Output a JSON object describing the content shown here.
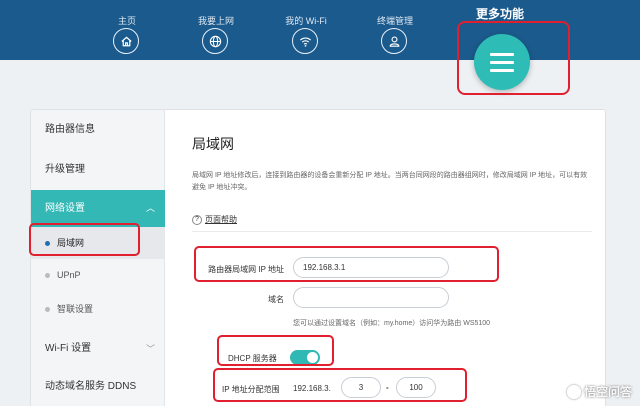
{
  "nav": {
    "items": [
      {
        "label": "主页",
        "icon": "home-icon"
      },
      {
        "label": "我要上网",
        "icon": "globe-icon"
      },
      {
        "label": "我的 Wi-Fi",
        "icon": "wifi-icon"
      },
      {
        "label": "终端管理",
        "icon": "user-icon"
      }
    ],
    "more_label": "更多功能",
    "more_icon": "menu-icon"
  },
  "sidebar": {
    "items": [
      {
        "label": "路由器信息"
      },
      {
        "label": "升级管理"
      },
      {
        "label": "网络设置",
        "active": true
      },
      {
        "label": "Wi-Fi 设置"
      },
      {
        "label": "动态域名服务 DDNS"
      }
    ],
    "sub_items": [
      {
        "label": "局域网",
        "current": true
      },
      {
        "label": "UPnP"
      },
      {
        "label": "智联设置"
      }
    ]
  },
  "main": {
    "title": "局域网",
    "description": "局域网 IP 地址修改后，连接到路由器的设备会重新分配 IP 地址。当两台同网段的路由器组网时，修改局域网 IP 地址，可以有效避免 IP 地址冲突。",
    "help_link": "页面帮助",
    "lan_ip_label": "路由器局域网 IP 地址",
    "lan_ip_value": "192.168.3.1",
    "domain_label": "域名",
    "domain_value": "",
    "domain_hint": "您可以通过设置域名（例如：my.home）访问华为路由 WS5100",
    "dhcp_label": "DHCP 服务器",
    "dhcp_enabled": true,
    "range_label": "IP 地址分配范围",
    "range_prefix": "192.168.3.",
    "range_start": "3",
    "range_sep": "-",
    "range_end": "100"
  },
  "watermark": "悟空问答",
  "colors": {
    "topbar": "#1b5a8c",
    "accent": "#34b8b6",
    "annotation": "#e0202e"
  }
}
